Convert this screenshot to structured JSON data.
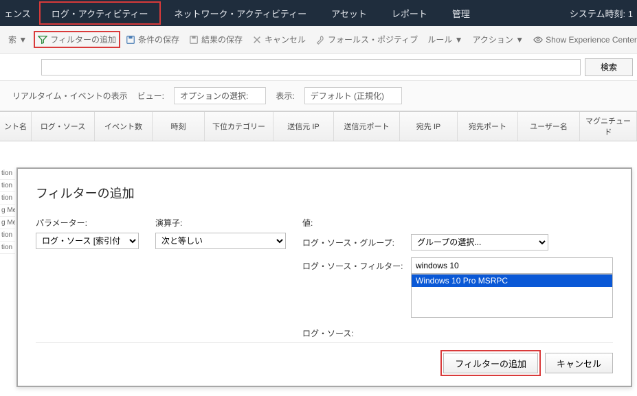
{
  "topnav": {
    "items": [
      {
        "label": "ェンス"
      },
      {
        "label": "ログ・アクティビティー"
      },
      {
        "label": "ネットワーク・アクティビティー"
      },
      {
        "label": "アセット"
      },
      {
        "label": "レポート"
      },
      {
        "label": "管理"
      }
    ],
    "clock_label": "システム時刻: 1"
  },
  "toolbar": {
    "search_left": "索 ▼",
    "add_filter": "フィルターの追加",
    "save_criteria": "条件の保存",
    "save_results": "結果の保存",
    "cancel": "キャンセル",
    "false_positive": "フォールス・ポジティブ",
    "rules": "ルール ▼",
    "actions": "アクション ▼",
    "show_exp": "Show Experience Center"
  },
  "searchrow": {
    "value": "",
    "search_btn": "検索"
  },
  "viewrow": {
    "realtime": "リアルタイム・イベントの表示",
    "view_lbl": "ビュー:",
    "view_val": "オプションの選択:",
    "display_lbl": "表示:",
    "display_val": "デフォルト (正規化)"
  },
  "columns": {
    "c0": "ント名",
    "c1": "ログ・ソース",
    "c2": "イベント数",
    "c3": "時刻",
    "c4": "下位カテゴリー",
    "c5": "送信元 IP",
    "c6": "送信元ポート",
    "c7": "宛先 IP",
    "c8": "宛先ポート",
    "c9": "ユーザー名",
    "c10": "マグニチュード"
  },
  "leftrows": [
    "tion",
    "tion",
    "tion",
    "g Me",
    "g Me",
    "tion",
    "tion"
  ],
  "dialog": {
    "title": "フィルターの追加",
    "param_label": "パラメーター:",
    "param_value": "ログ・ソース [索引付",
    "op_label": "演算子:",
    "op_value": "次と等しい",
    "val_label": "値:",
    "group_label": "ログ・ソース・グループ:",
    "group_value": "グループの選択...",
    "filter_label": "ログ・ソース・フィルター:",
    "filter_value": "windows 10",
    "source_label": "ログ・ソース:",
    "list_option": "Windows 10 Pro MSRPC",
    "add_btn": "フィルターの追加",
    "cancel_btn": "キャンセル"
  }
}
